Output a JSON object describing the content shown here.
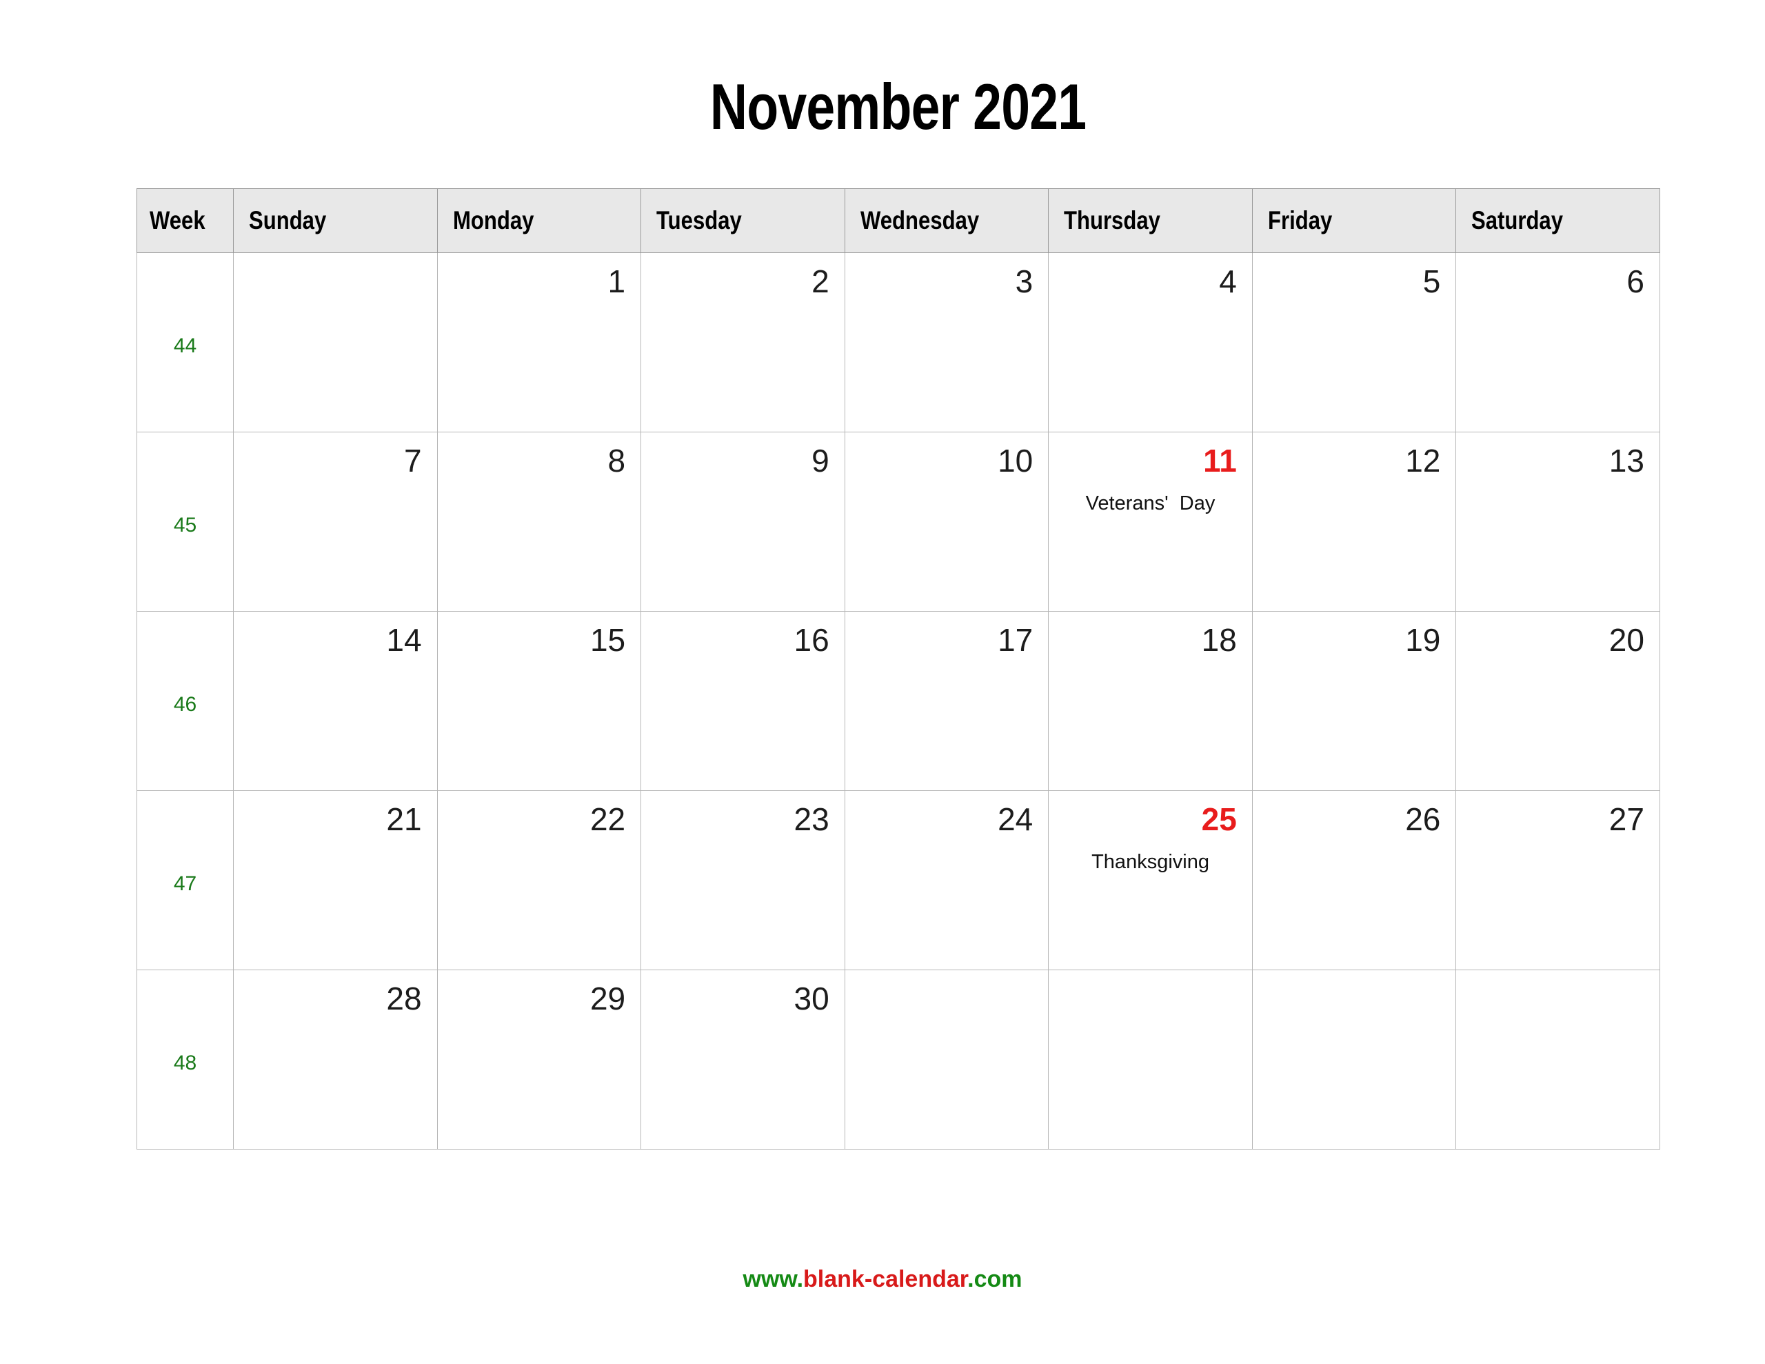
{
  "title": "November 2021",
  "month": "November",
  "year": "2021",
  "colors": {
    "week_number": "#1a7a1a",
    "holiday": "#e81c1c",
    "header_background": "#e8e8e8",
    "grid_border": "#b6b6b6",
    "header_border": "#9a9a9a",
    "footer_green": "#158a15",
    "footer_red": "#d81a1a"
  },
  "table": {
    "headers": [
      "Week",
      "Sunday",
      "Monday",
      "Tuesday",
      "Wednesday",
      "Thursday",
      "Friday",
      "Saturday"
    ],
    "rows": [
      {
        "week": "44",
        "days": [
          {
            "num": "",
            "event": "",
            "holiday": false
          },
          {
            "num": "1",
            "event": "",
            "holiday": false
          },
          {
            "num": "2",
            "event": "",
            "holiday": false
          },
          {
            "num": "3",
            "event": "",
            "holiday": false
          },
          {
            "num": "4",
            "event": "",
            "holiday": false
          },
          {
            "num": "5",
            "event": "",
            "holiday": false
          },
          {
            "num": "6",
            "event": "",
            "holiday": false
          }
        ]
      },
      {
        "week": "45",
        "days": [
          {
            "num": "7",
            "event": "",
            "holiday": false
          },
          {
            "num": "8",
            "event": "",
            "holiday": false
          },
          {
            "num": "9",
            "event": "",
            "holiday": false
          },
          {
            "num": "10",
            "event": "",
            "holiday": false
          },
          {
            "num": "11",
            "event": "Veterans'  Day",
            "holiday": true
          },
          {
            "num": "12",
            "event": "",
            "holiday": false
          },
          {
            "num": "13",
            "event": "",
            "holiday": false
          }
        ]
      },
      {
        "week": "46",
        "days": [
          {
            "num": "14",
            "event": "",
            "holiday": false
          },
          {
            "num": "15",
            "event": "",
            "holiday": false
          },
          {
            "num": "16",
            "event": "",
            "holiday": false
          },
          {
            "num": "17",
            "event": "",
            "holiday": false
          },
          {
            "num": "18",
            "event": "",
            "holiday": false
          },
          {
            "num": "19",
            "event": "",
            "holiday": false
          },
          {
            "num": "20",
            "event": "",
            "holiday": false
          }
        ]
      },
      {
        "week": "47",
        "days": [
          {
            "num": "21",
            "event": "",
            "holiday": false
          },
          {
            "num": "22",
            "event": "",
            "holiday": false
          },
          {
            "num": "23",
            "event": "",
            "holiday": false
          },
          {
            "num": "24",
            "event": "",
            "holiday": false
          },
          {
            "num": "25",
            "event": "Thanksgiving",
            "holiday": true
          },
          {
            "num": "26",
            "event": "",
            "holiday": false
          },
          {
            "num": "27",
            "event": "",
            "holiday": false
          }
        ]
      },
      {
        "week": "48",
        "days": [
          {
            "num": "28",
            "event": "",
            "holiday": false
          },
          {
            "num": "29",
            "event": "",
            "holiday": false
          },
          {
            "num": "30",
            "event": "",
            "holiday": false
          },
          {
            "num": "",
            "event": "",
            "holiday": false
          },
          {
            "num": "",
            "event": "",
            "holiday": false
          },
          {
            "num": "",
            "event": "",
            "holiday": false
          },
          {
            "num": "",
            "event": "",
            "holiday": false
          }
        ]
      }
    ]
  },
  "footer": {
    "part1": "www.",
    "part2": "blank-calendar",
    "part3": ".com",
    "full": "www.blank-calendar.com"
  }
}
